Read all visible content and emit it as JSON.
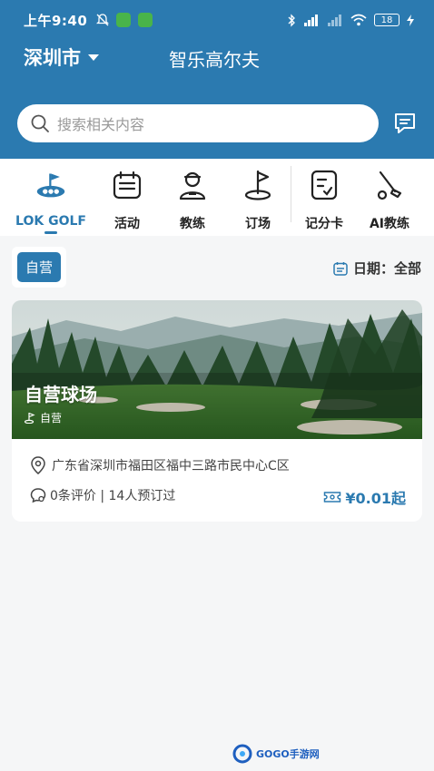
{
  "statusbar": {
    "time": "上午9:40",
    "battery": "18"
  },
  "header": {
    "city": "深圳市",
    "app_title": "智乐高尔夫"
  },
  "search": {
    "placeholder": "搜索相关内容"
  },
  "categories": [
    {
      "label": "LOK GOLF",
      "icon": "golf-logo-icon",
      "active": true
    },
    {
      "label": "活动",
      "icon": "calendar-icon"
    },
    {
      "label": "教练",
      "icon": "coach-icon"
    },
    {
      "label": "订场",
      "icon": "flag-icon"
    },
    {
      "label": "记分卡",
      "icon": "scorecard-icon"
    },
    {
      "label": "AI教练",
      "icon": "golf-club-icon"
    }
  ],
  "filter": {
    "tag": "自营",
    "date_label": "日期：全部"
  },
  "venue": {
    "name": "自营球场",
    "type": "自营",
    "address": "广东省深圳市福田区福中三路市民中心C区",
    "stats": "0条评价 | 14人预订过",
    "price": "¥0.01起"
  },
  "watermark": {
    "text": "GOGO手游网"
  },
  "colors": {
    "primary": "#2b7ab0",
    "background": "#f5f6f7"
  }
}
